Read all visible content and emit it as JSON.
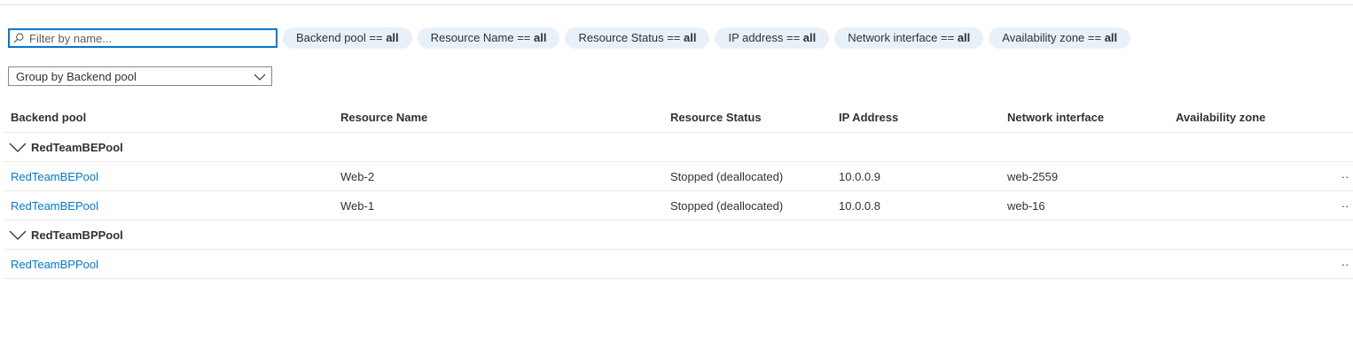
{
  "search": {
    "placeholder": "Filter by name..."
  },
  "filters": [
    {
      "prefix": "Backend pool == ",
      "value": "all"
    },
    {
      "prefix": "Resource Name == ",
      "value": "all"
    },
    {
      "prefix": "Resource Status == ",
      "value": "all"
    },
    {
      "prefix": "IP address == ",
      "value": "all"
    },
    {
      "prefix": "Network interface == ",
      "value": "all"
    },
    {
      "prefix": "Availability zone == ",
      "value": "all"
    }
  ],
  "group_by": {
    "label": "Group by Backend pool"
  },
  "columns": [
    "Backend pool",
    "Resource Name",
    "Resource Status",
    "IP Address",
    "Network interface",
    "Availability zone"
  ],
  "groups": [
    {
      "name": "RedTeamBEPool",
      "rows": [
        {
          "pool": "RedTeamBEPool",
          "resource": "Web-2",
          "status": "Stopped (deallocated)",
          "ip": "10.0.0.9",
          "nic": "web-2559",
          "zone": ""
        },
        {
          "pool": "RedTeamBEPool",
          "resource": "Web-1",
          "status": "Stopped (deallocated)",
          "ip": "10.0.0.8",
          "nic": "web-16",
          "zone": ""
        }
      ]
    },
    {
      "name": "RedTeamBPPool",
      "rows": [
        {
          "pool": "RedTeamBPPool",
          "resource": "",
          "status": "",
          "ip": "",
          "nic": "",
          "zone": ""
        }
      ]
    }
  ],
  "row_actions_glyph": "··"
}
